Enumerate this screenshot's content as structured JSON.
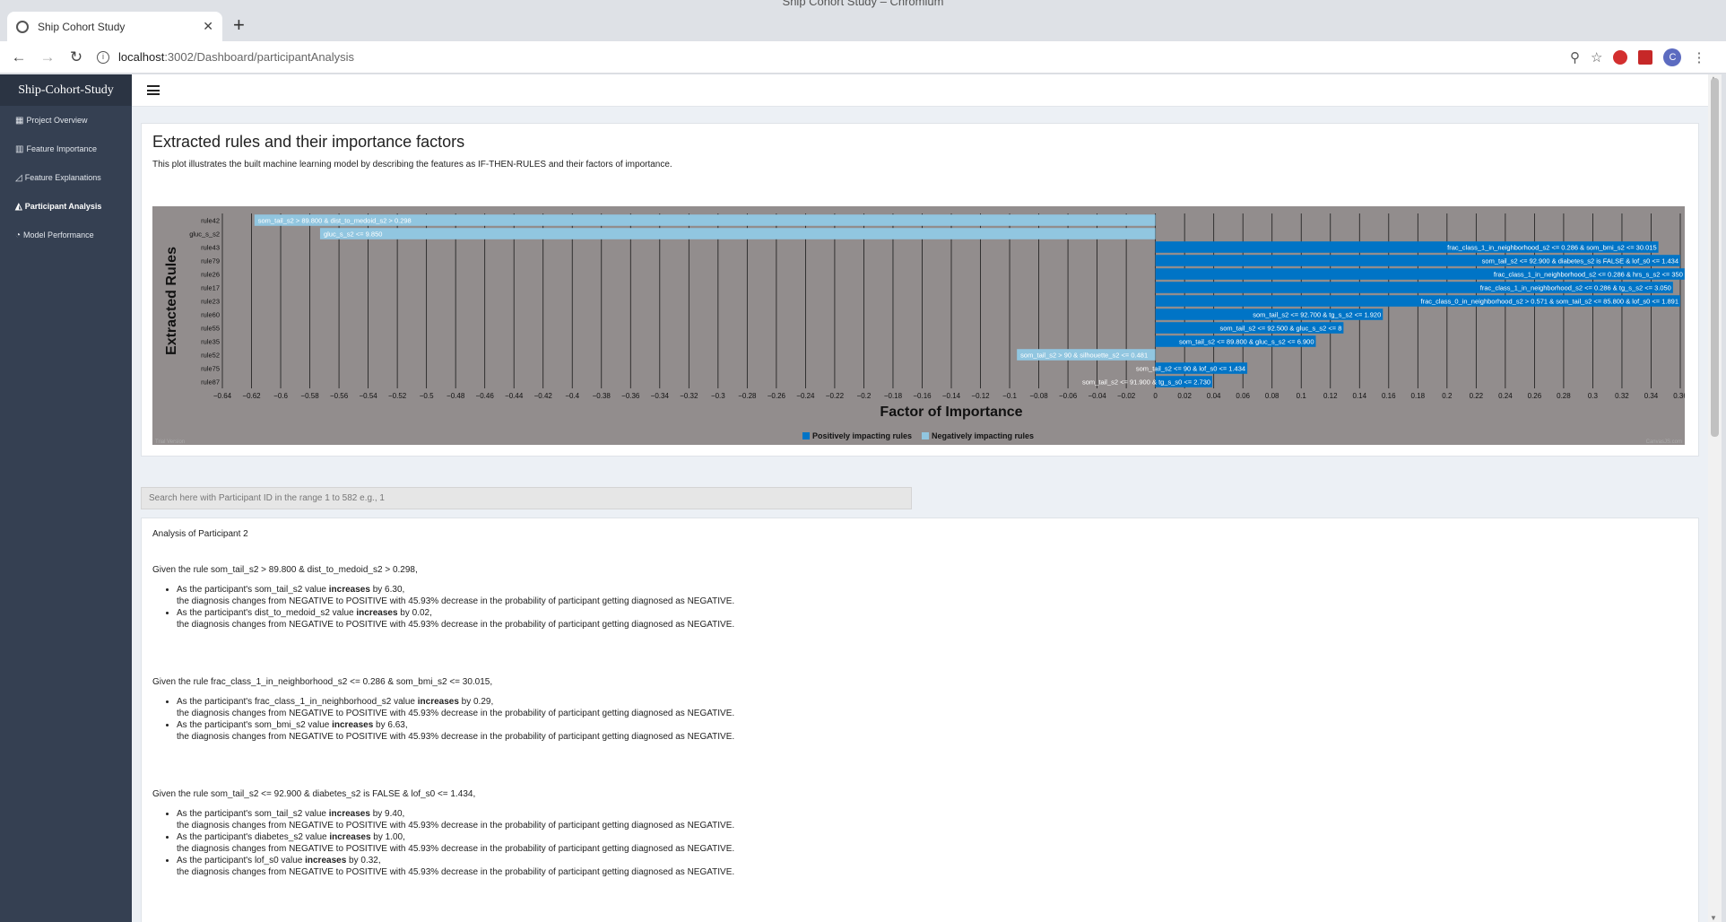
{
  "window": {
    "title": "Ship Cohort Study – Chromium"
  },
  "tab": {
    "title": "Ship  Cohort  Study",
    "close": "✕",
    "new": "+"
  },
  "toolbar": {
    "url_host": "localhost",
    "url_rest": ":3002/Dashboard/participantAnalysis",
    "avatar": "C",
    "icons": [
      "back-icon",
      "forward-icon",
      "reload-icon",
      "info-icon",
      "zoom-icon",
      "star-icon",
      "extension-icon",
      "extension-icon",
      "profile-avatar",
      "menu-dots-icon"
    ]
  },
  "sidebar": {
    "brand": "Ship-Cohort-Study",
    "items": [
      {
        "label": "Project Overview",
        "icon": "grid-icon"
      },
      {
        "label": "Feature Importance",
        "icon": "bar-chart-icon"
      },
      {
        "label": "Feature Explanations",
        "icon": "line-chart-icon"
      },
      {
        "label": "Participant Analysis",
        "icon": "area-chart-icon",
        "active": true
      },
      {
        "label": "Model Performance",
        "icon": "pie-chart-icon"
      }
    ]
  },
  "panel": {
    "title": "Extracted rules and their importance factors",
    "description": "This plot illustrates the built machine learning model by describing the features as IF-THEN-RULES and their factors of importance."
  },
  "chart_data": {
    "type": "bar",
    "orientation": "horizontal",
    "xlabel": "Factor of Importance",
    "ylabel": "Extracted Rules",
    "xlim": [
      -0.64,
      0.36
    ],
    "xticks": [
      -0.64,
      -0.62,
      -0.6,
      -0.58,
      -0.56,
      -0.54,
      -0.52,
      -0.5,
      -0.48,
      -0.46,
      -0.44,
      -0.42,
      -0.4,
      -0.38,
      -0.36,
      -0.34,
      -0.32,
      -0.3,
      -0.28,
      -0.26,
      -0.24,
      -0.22,
      -0.2,
      -0.18,
      -0.16,
      -0.14,
      -0.12,
      -0.1,
      -0.08,
      -0.06,
      -0.04,
      -0.02,
      0,
      0.02,
      0.04,
      0.06,
      0.08,
      0.1,
      0.12,
      0.14,
      0.16,
      0.18,
      0.2,
      0.22,
      0.24,
      0.26,
      0.28,
      0.3,
      0.32,
      0.34,
      0.36
    ],
    "xtick_labels": [
      "−0.64",
      "−0.62",
      "−0.6",
      "−0.58",
      "−0.56",
      "−0.54",
      "−0.52",
      "−0.5",
      "−0.48",
      "−0.46",
      "−0.44",
      "−0.42",
      "−0.4",
      "−0.38",
      "−0.36",
      "−0.34",
      "−0.32",
      "−0.3",
      "−0.28",
      "−0.26",
      "−0.24",
      "−0.22",
      "−0.2",
      "−0.18",
      "−0.16",
      "−0.14",
      "−0.12",
      "−0.1",
      "−0.08",
      "−0.06",
      "−0.04",
      "−0.02",
      "0",
      "0.02",
      "0.04",
      "0.06",
      "0.08",
      "0.1",
      "0.12",
      "0.14",
      "0.16",
      "0.18",
      "0.2",
      "0.22",
      "0.24",
      "0.26",
      "0.28",
      "0.3",
      "0.32",
      "0.34",
      "0.36"
    ],
    "categories": [
      "rule42",
      "gluc_s_s2",
      "rule43",
      "rule79",
      "rule26",
      "rule17",
      "rule23",
      "rule60",
      "rule55",
      "rule35",
      "rule52",
      "rule75",
      "rule87"
    ],
    "values": [
      -0.618,
      -0.573,
      0.345,
      0.36,
      0.363,
      0.355,
      0.36,
      0.156,
      0.129,
      0.11,
      -0.095,
      0.063,
      0.039
    ],
    "bar_labels": [
      "som_tail_s2 > 89.800 & dist_to_medoid_s2 > 0.298",
      "gluc_s_s2 <= 9.850",
      "frac_class_1_in_neighborhood_s2 <= 0.286 & som_bmi_s2 <= 30.015",
      "som_tail_s2 <= 92.900 & diabetes_s2 is FALSE & lof_s0 <= 1.434",
      "frac_class_1_in_neighborhood_s2 <= 0.286 & hrs_s_s2 <= 350",
      "frac_class_1_in_neighborhood_s2 <= 0.286 & tg_s_s2 <= 3.050",
      "frac_class_0_in_neighborhood_s2 > 0.571 & som_tail_s2 <= 85.800 & lof_s0 <= 1.891",
      "som_tail_s2 <= 92.700 & tg_s_s2 <= 1.920",
      "som_tail_s2 <= 92.500 & gluc_s_s2 <= 8",
      "som_tail_s2 <= 89.800 & gluc_s_s2 <= 6.900",
      "som_tail_s2 > 90 & silhouette_s2 <= 0.481",
      "som_tail_s2 <= 90 & lof_s0 <= 1.434",
      "som_tail_s2 <= 91.900 & tg_s_s0 <= 2.730"
    ],
    "legend": [
      "Positively impacting rules",
      "Negatively impacting rules"
    ],
    "legend_placement": "bottom-center",
    "grid": true,
    "colors": {
      "positive": "#0074c6",
      "negative": "#91c6e0",
      "background": "#928d8d",
      "grid": "#1a1a1a"
    },
    "credits": "CanvasJS.com",
    "trial": "Trial Version"
  },
  "search": {
    "placeholder": "Search here with Participant ID in the range 1 to 582   e.g., 1"
  },
  "analysis": {
    "heading": "Analysis of Participant 2",
    "rules": [
      {
        "title": "Given the rule som_tail_s2 > 89.800 & dist_to_medoid_s2 > 0.298,",
        "items": [
          {
            "pre": "As the participant's som_tail_s2 value ",
            "bold": "increases",
            "post": " by 6.30,",
            "line2": "the diagnosis changes from NEGATIVE to POSITIVE with 45.93% decrease in the probability of participant getting diagnosed as NEGATIVE."
          },
          {
            "pre": "As the participant's dist_to_medoid_s2 value ",
            "bold": "increases",
            "post": " by 0.02,",
            "line2": "the diagnosis changes from NEGATIVE to POSITIVE with 45.93% decrease in the probability of participant getting diagnosed as NEGATIVE."
          }
        ]
      },
      {
        "title": "Given the rule frac_class_1_in_neighborhood_s2 <= 0.286 & som_bmi_s2 <= 30.015,",
        "items": [
          {
            "pre": "As the participant's frac_class_1_in_neighborhood_s2 value ",
            "bold": "increases",
            "post": " by 0.29,",
            "line2": "the diagnosis changes from NEGATIVE to POSITIVE with 45.93% decrease in the probability of participant getting diagnosed as NEGATIVE."
          },
          {
            "pre": "As the participant's som_bmi_s2 value ",
            "bold": "increases",
            "post": " by 6.63,",
            "line2": "the diagnosis changes from NEGATIVE to POSITIVE with 45.93% decrease in the probability of participant getting diagnosed as NEGATIVE."
          }
        ]
      },
      {
        "title": "Given the rule som_tail_s2 <= 92.900 & diabetes_s2 is FALSE & lof_s0 <= 1.434,",
        "items": [
          {
            "pre": "As the participant's som_tail_s2 value ",
            "bold": "increases",
            "post": " by 9.40,",
            "line2": "the diagnosis changes from NEGATIVE to POSITIVE with 45.93% decrease in the probability of participant getting diagnosed as NEGATIVE."
          },
          {
            "pre": "As the participant's diabetes_s2 value ",
            "bold": "increases",
            "post": " by 1.00,",
            "line2": "the diagnosis changes from NEGATIVE to POSITIVE with 45.93% decrease in the probability of participant getting diagnosed as NEGATIVE."
          },
          {
            "pre": "As the participant's lof_s0 value ",
            "bold": "increases",
            "post": " by 0.32,",
            "line2": "the diagnosis changes from NEGATIVE to POSITIVE with 45.93% decrease in the probability of participant getting diagnosed as NEGATIVE."
          }
        ]
      }
    ]
  }
}
